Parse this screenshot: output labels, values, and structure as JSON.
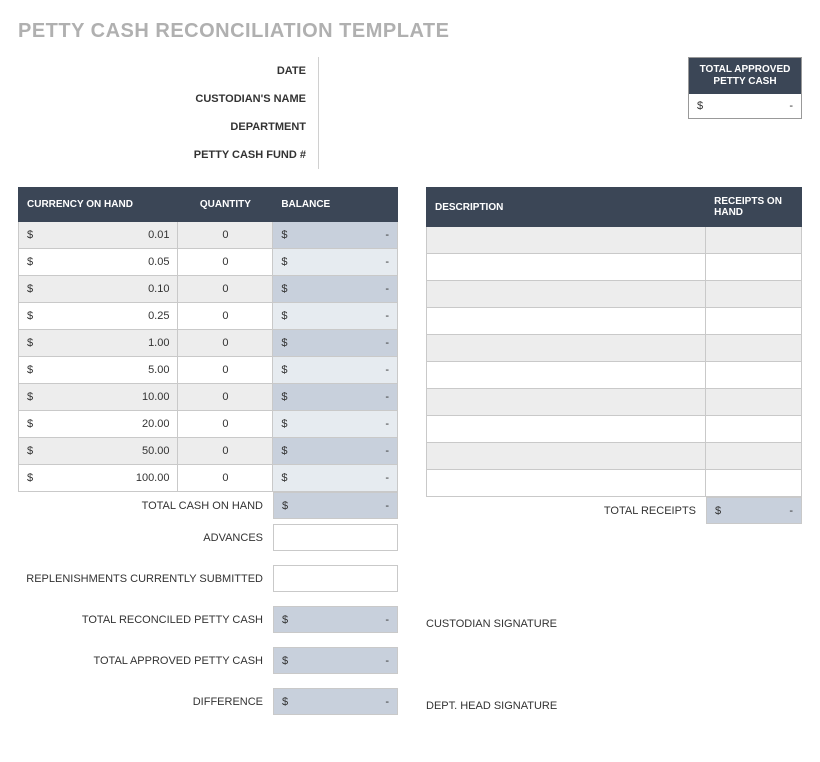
{
  "title": "PETTY CASH RECONCILIATION TEMPLATE",
  "meta": {
    "date_label": "DATE",
    "custodian_label": "CUSTODIAN'S NAME",
    "department_label": "DEPARTMENT",
    "fund_label": "PETTY CASH FUND #"
  },
  "approved_box": {
    "header": "TOTAL APPROVED PETTY CASH",
    "symbol": "$",
    "value": "-"
  },
  "currency_table": {
    "headers": {
      "currency": "CURRENCY ON HAND",
      "quantity": "QUANTITY",
      "balance": "BALANCE"
    },
    "rows": [
      {
        "denom": "0.01",
        "qty": "0",
        "bal": "-"
      },
      {
        "denom": "0.05",
        "qty": "0",
        "bal": "-"
      },
      {
        "denom": "0.10",
        "qty": "0",
        "bal": "-"
      },
      {
        "denom": "0.25",
        "qty": "0",
        "bal": "-"
      },
      {
        "denom": "1.00",
        "qty": "0",
        "bal": "-"
      },
      {
        "denom": "5.00",
        "qty": "0",
        "bal": "-"
      },
      {
        "denom": "10.00",
        "qty": "0",
        "bal": "-"
      },
      {
        "denom": "20.00",
        "qty": "0",
        "bal": "-"
      },
      {
        "denom": "50.00",
        "qty": "0",
        "bal": "-"
      },
      {
        "denom": "100.00",
        "qty": "0",
        "bal": "-"
      }
    ],
    "symbol": "$"
  },
  "receipts_table": {
    "headers": {
      "description": "DESCRIPTION",
      "receipts": "RECEIPTS ON HAND"
    },
    "row_count": 10
  },
  "totals": {
    "total_cash_label": "TOTAL CASH ON HAND",
    "total_cash_value": "-",
    "advances_label": "ADVANCES",
    "advances_value": "",
    "replenishments_label": "REPLENISHMENTS CURRENTLY SUBMITTED",
    "replenishments_value": "",
    "reconciled_label": "TOTAL RECONCILED PETTY CASH",
    "reconciled_value": "-",
    "approved_label": "TOTAL APPROVED PETTY CASH",
    "approved_value": "-",
    "difference_label": "DIFFERENCE",
    "difference_value": "-",
    "symbol": "$"
  },
  "right_totals": {
    "total_receipts_label": "TOTAL RECEIPTS",
    "total_receipts_value": "-",
    "symbol": "$"
  },
  "signatures": {
    "custodian": "CUSTODIAN SIGNATURE",
    "dept_head": "DEPT. HEAD SIGNATURE"
  }
}
